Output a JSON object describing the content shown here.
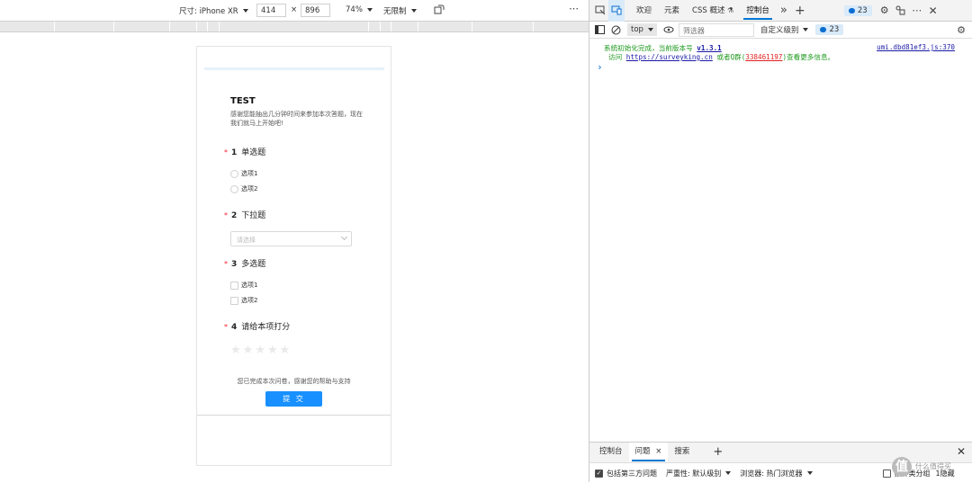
{
  "devbar": {
    "device_label": "尺寸: iPhone XR",
    "width": "414",
    "times": "×",
    "height": "896",
    "zoom": "74%",
    "throttle": "无限制",
    "more": "⋯"
  },
  "survey": {
    "title": "TEST",
    "desc": "感谢您能抽出几分钟时间来参加本次答题，现在我们就马上开始吧!",
    "questions": [
      {
        "required": "*",
        "num": "1",
        "title": "单选题",
        "options": [
          "选项1",
          "选项2"
        ]
      },
      {
        "required": "*",
        "num": "2",
        "title": "下拉题",
        "placeholder": "请选择"
      },
      {
        "required": "*",
        "num": "3",
        "title": "多选题",
        "options": [
          "选项1",
          "选项2"
        ]
      },
      {
        "required": "*",
        "num": "4",
        "title": "请给本项打分",
        "rating": 0,
        "rating_max": 5
      }
    ],
    "thanks": "您已完成本次问卷，感谢您的帮助与支持",
    "submit": "提 交"
  },
  "devtools": {
    "tabs": [
      "欢迎",
      "元素",
      "CSS 概述",
      "控制台"
    ],
    "active_tab": "控制台",
    "more_tabs": "»",
    "add_tab": "+",
    "issues_count": "23",
    "context": "top",
    "filter_placeholder": "筛选器",
    "levels": "自定义级别",
    "issues_count2": "23",
    "console": {
      "line1_text": "系统初始化完成，当前版本号 ",
      "line1_version": "v1.3.1",
      "line1_source": "umi.dbd81ef3.js:370",
      "line2_pre": "访问 ",
      "line2_link": "https://surveyking.cn",
      "line2_mid": " 或者Q群(",
      "line2_qq": "338461197",
      "line2_post": ")查看更多信息。",
      "prompt": "›"
    },
    "drawer": {
      "tabs": [
        "控制台",
        "问题",
        "搜索"
      ],
      "active": "问题",
      "close": "×",
      "add": "+",
      "include_third_party": "包括第三方问题",
      "severity": "严重性: 默认级别",
      "browser": "浏览器: 热门浏览器",
      "group_by": "按种类分组",
      "hidden": "1隐藏"
    }
  },
  "watermark": {
    "glyph": "值",
    "text": "什么值得买"
  }
}
